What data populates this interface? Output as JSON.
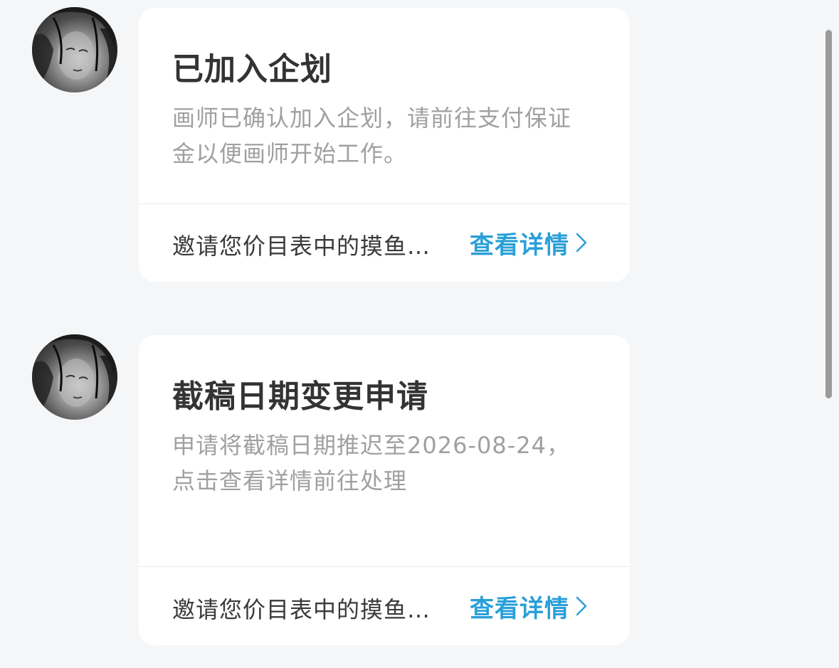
{
  "messages": [
    {
      "title": "已加入企划",
      "description": "画师已确认加入企划，请前往支付保证金以便画师开始工作。",
      "footer_text": "邀请您价目表中的摸鱼…",
      "link_label": "查看详情"
    },
    {
      "title": "截稿日期变更申请",
      "description": "申请将截稿日期推迟至2026-08-24，点击查看详情前往处理",
      "footer_text": "邀请您价目表中的摸鱼…",
      "link_label": "查看详情"
    }
  ],
  "colors": {
    "background": "#f5f6f8",
    "card": "#ffffff",
    "title": "#333333",
    "description": "#a0a0a0",
    "link": "#2a9fd8"
  },
  "icons": {
    "avatar": "avatar-image",
    "link_arrow": "chevron-right-icon"
  }
}
